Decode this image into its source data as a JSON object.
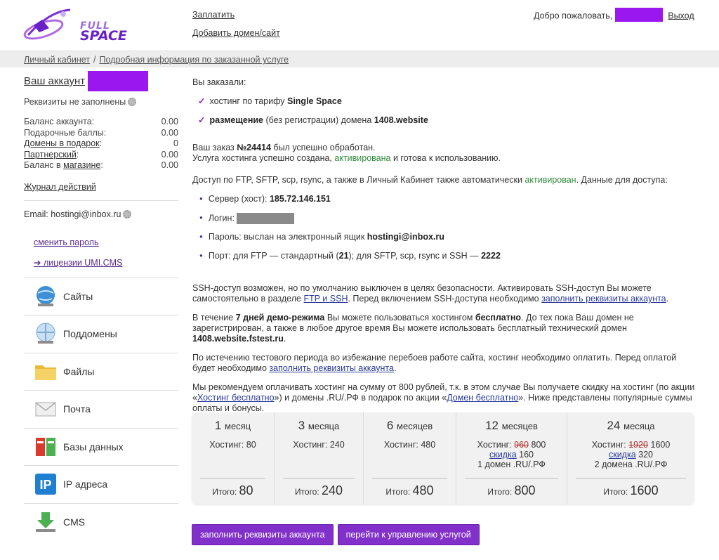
{
  "brand": {
    "line1": "FULL",
    "line2": "SPACE"
  },
  "header": {
    "links": [
      "Заплатить",
      "Добавить домен/сайт"
    ],
    "welcome": "Добро пожаловать,",
    "logout": "Выход"
  },
  "breadcrumb": {
    "items": [
      "Личный кабинет",
      "Подробная информация по заказанной услуге"
    ],
    "separator": "/"
  },
  "sidebar": {
    "account_label": "Ваш аккаунт",
    "requisites_note": "Реквизиты не заполнены",
    "balances": [
      {
        "label": "Баланс аккаунта:",
        "value": "0.00",
        "link": false
      },
      {
        "label": "Подарочные баллы:",
        "value": "0.00",
        "link": false
      },
      {
        "label": "Домены в подарок",
        "suffix": ":",
        "value": "0",
        "link": true
      },
      {
        "label": "Партнерский",
        "suffix": ":",
        "value": "0.00",
        "link": true
      },
      {
        "label_prefix": "Баланс в ",
        "label": "магазине",
        "suffix": ":",
        "value": "0.00",
        "link": true
      }
    ],
    "journal": "Журнал действий",
    "email_label": "Email: hostingi@inbox.ru",
    "change_password": "сменить пароль",
    "licenses": "лицензии UMI.CMS",
    "nav": [
      {
        "label": "Сайты",
        "icon": "globe-icon"
      },
      {
        "label": "Поддомены",
        "icon": "subdomain-globe-icon"
      },
      {
        "label": "Файлы",
        "icon": "folder-icon"
      },
      {
        "label": "Почта",
        "icon": "envelope-icon"
      },
      {
        "label": "Базы данных",
        "icon": "database-icon"
      },
      {
        "label": "IP адреса",
        "icon": "ip-icon"
      },
      {
        "label": "CMS",
        "icon": "download-icon"
      }
    ]
  },
  "main": {
    "ordered_label": "Вы заказали:",
    "order_items": {
      "i1_prefix": "хостинг по тарифу ",
      "i1_bold": "Single Space",
      "i2_bold": "размещение",
      "i2_mid": " (без регистрации) домена ",
      "i2_domain": "1408.website"
    },
    "order": {
      "p1": "Ваш заказ ",
      "number": "№24414",
      "p2": " был успешно обработан.",
      "line2_a": "Услуга хостинга успешно создана, ",
      "line2_green": "активирована",
      "line2_b": " и готова к использованию."
    },
    "access": {
      "intro_a": "Доступ по FTP, SFTP, scp, rsync, а также в Личный Кабинет также автоматически ",
      "intro_green": "активирован",
      "intro_b": ". Данные для доступа:",
      "server_label": "Сервер (хост): ",
      "server_value": "185.72.146.151",
      "login_label": "Логин: ",
      "password_label": "Пароль: выслан на электронный ящик ",
      "password_email": "hostingi@inbox.ru",
      "port_a": "Порт: для FTP — стандартный (",
      "port_ftp": "21",
      "port_b": "); для SFTP, scp, rsync и SSH — ",
      "port_ssh": "2222"
    },
    "ssh": {
      "a": "SSH-доступ возможен, но по умолчанию выключен в целях безопасности. Активировать SSH-доступ Вы можете самостоятельно в разделе ",
      "link1": "FTP и SSH",
      "b": ". Перед включением SSH-доступа необходимо ",
      "link2": "заполнить реквизиты аккаунта",
      "c": "."
    },
    "demo": {
      "a": "В течение ",
      "bold1": "7 дней демо-режима",
      "b": " Вы можете пользоваться хостингом ",
      "bold2": "бесплатно",
      "c": ". До тех пока Ваш домен не зарегистрирован, а также в любое другое время Вы можете использовать бесплатный технический домен ",
      "bold3": "1408.website.fstest.ru",
      "d": "."
    },
    "trial": {
      "a": "По истечению тестового периода во избежание перебоев работе сайта, хостинг необходимо оплатить. Перед оплатой будет необходимо ",
      "link": "заполнить реквизиты аккаунта",
      "b": "."
    },
    "recommend": {
      "a": "Мы рекомендуем оплачивать хостинг на сумму от 800 рублей, т.к. в этом случае Вы получаете скидку на хостинг (по акции «",
      "link1": "Хостинг бесплатно",
      "b": "») и домены .RU/.РФ в подарок по акции «",
      "link2": "Домен бесплатно",
      "c": "». Ниже представлены популярные суммы оплаты и бонусы."
    }
  },
  "pricing": {
    "total_label": "Итого:",
    "columns": [
      {
        "num": "1",
        "unit": "месяц",
        "hosting": "Хостинг: 80",
        "total": "80"
      },
      {
        "num": "3",
        "unit": "месяца",
        "hosting": "Хостинг: 240",
        "total": "240"
      },
      {
        "num": "6",
        "unit": "месяцев",
        "hosting": "Хостинг: 480",
        "total": "480"
      },
      {
        "num": "12",
        "unit": "месяцев",
        "hosting_label": "Хостинг: ",
        "old": "960",
        "new": "800",
        "discount_label": "скидка",
        "discount": "160",
        "bonus": "1 домен .RU/.РФ",
        "total": "800"
      },
      {
        "num": "24",
        "unit": "месяца",
        "hosting_label": "Хостинг: ",
        "old": "1920",
        "new": "1600",
        "discount_label": "скидка",
        "discount": "320",
        "bonus": "2 домена .RU/.РФ",
        "total": "1600"
      }
    ]
  },
  "buttons": {
    "fill": "заполнить реквизиты аккаунта",
    "manage": "перейти к управлению услугой"
  },
  "colors": {
    "accent": "#8130c9",
    "active_green": "#2e8b3a",
    "redaction": "#9a17ef"
  }
}
